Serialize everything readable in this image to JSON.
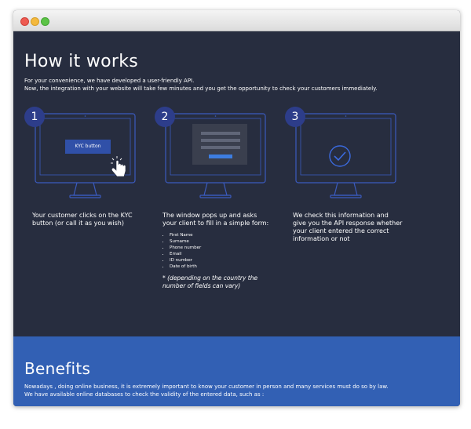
{
  "how": {
    "title": "How it works",
    "intro_line1": "For your convenience, we have developed a user-friendly API.",
    "intro_line2": "Now, the integration with your website will take few minutes and you get the opportunity to check your customers immediately."
  },
  "steps": [
    {
      "number": "1",
      "button_label": "KYC button",
      "caption": "Your customer clicks on the KYC button (or call it as you wish)"
    },
    {
      "number": "2",
      "caption": "The window pops up and asks your client to fill in a simple form:",
      "fields": [
        "First Name",
        "Surname",
        "Phone number",
        "Email",
        "ID number",
        "Date of birth"
      ],
      "note": "* (depending on the country the number of fields can vary)"
    },
    {
      "number": "3",
      "caption": "We check this information and give you the API response whether your client entered the correct information or not"
    }
  ],
  "benefits": {
    "title": "Benefits",
    "line1": "Nowadays , doing online business, it is extremely important to know your customer in person and many services must do so by law.",
    "line2": "We have available online databases to check the validity of the entered data, such as :"
  },
  "colors": {
    "background": "#272d3f",
    "outline": "#3b5bbf",
    "badge": "#2d3d8a",
    "button": "#3050a8",
    "benefits_band": "#3260b4"
  }
}
